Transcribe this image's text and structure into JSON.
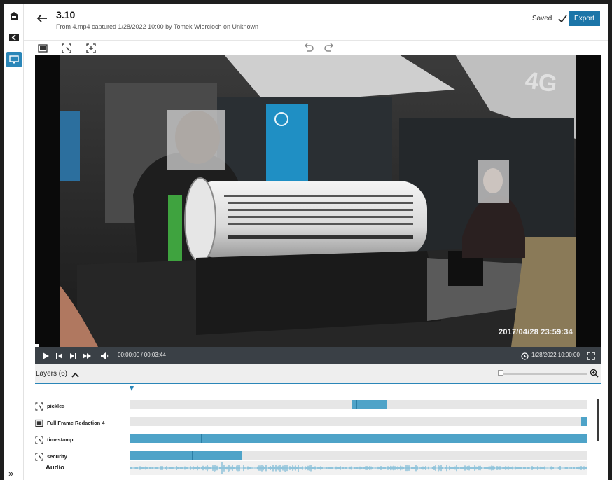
{
  "header": {
    "title": "3.10",
    "subtitle": "From 4.mp4 captured 1/28/2022 10:00 by Tomek Wiercioch on Unknown",
    "saved_label": "Saved",
    "export_label": "Export"
  },
  "rail": {
    "items": [
      {
        "icon": "home-icon",
        "active": false
      },
      {
        "icon": "back-folder-icon",
        "active": false
      },
      {
        "icon": "monitor-icon",
        "active": true
      }
    ],
    "expand_label": "»"
  },
  "toolbar": {
    "tools": [
      "full-frame-tool-icon",
      "box-select-tool-icon",
      "add-box-tool-icon"
    ],
    "undo_icon": "undo-icon",
    "redo_icon": "redo-icon"
  },
  "video": {
    "overlay_timestamp": "2017/04/28  23:59:34",
    "blur_regions": 2
  },
  "player": {
    "time": "00:00:00 / 00:03:44",
    "date": "1/28/2022 10:00:00",
    "progress": 0.0
  },
  "layers": {
    "label": "Layers (6)",
    "items": [
      {
        "name": "pickles",
        "icon": "box-select-icon",
        "segments": [
          {
            "start": 0.485,
            "end": 0.562
          }
        ],
        "markers": [
          0.495
        ]
      },
      {
        "name": "Full Frame Redaction 4",
        "icon": "full-frame-icon",
        "segments": [
          {
            "start": 0.986,
            "end": 1.0
          }
        ],
        "markers": []
      },
      {
        "name": "timestamp",
        "icon": "box-select-icon",
        "segments": [
          {
            "start": 0.0,
            "end": 1.0
          }
        ],
        "markers": [
          0.155
        ]
      },
      {
        "name": "security",
        "icon": "box-select-icon",
        "segments": [
          {
            "start": 0.0,
            "end": 0.243
          }
        ],
        "markers": [
          0.13,
          0.135
        ]
      }
    ],
    "audio_label": "Audio"
  },
  "zoom": {
    "level": 0.0
  },
  "colors": {
    "accent": "#1b75a8",
    "segment": "#4ea3c8",
    "track": "#e6e6e6",
    "controls_bg": "#3a4046"
  }
}
